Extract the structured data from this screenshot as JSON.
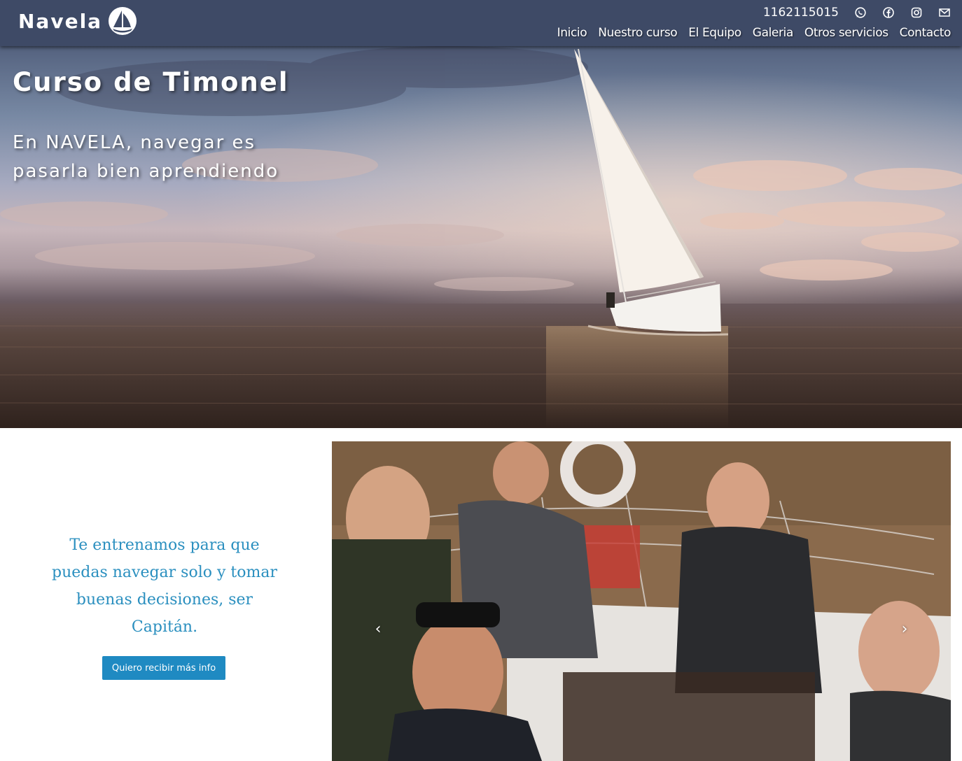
{
  "header": {
    "brand": "Navela",
    "phone": "1162115015",
    "social_icons": [
      "whatsapp-icon",
      "facebook-icon",
      "instagram-icon",
      "mail-icon"
    ],
    "nav": [
      {
        "label": "Inicio"
      },
      {
        "label": "Nuestro curso"
      },
      {
        "label": "El Equipo"
      },
      {
        "label": "Galeria"
      },
      {
        "label": "Otros servicios"
      },
      {
        "label": "Contacto"
      }
    ]
  },
  "hero": {
    "title": "Curso de Timonel",
    "subtitle": "En NAVELA, navegar es pasarla bien aprendiendo"
  },
  "intro": {
    "text": "Te entrenamos para que puedas navegar solo y tomar buenas decisiones, ser Capitán.",
    "button_label": "Quiero recibir más info"
  },
  "carousel": {
    "prev_symbol": "‹",
    "next_symbol": "›"
  },
  "colors": {
    "header_bg": "#3e4a66",
    "accent_text": "#2a8fbf",
    "button_bg": "#1f8ac2"
  }
}
